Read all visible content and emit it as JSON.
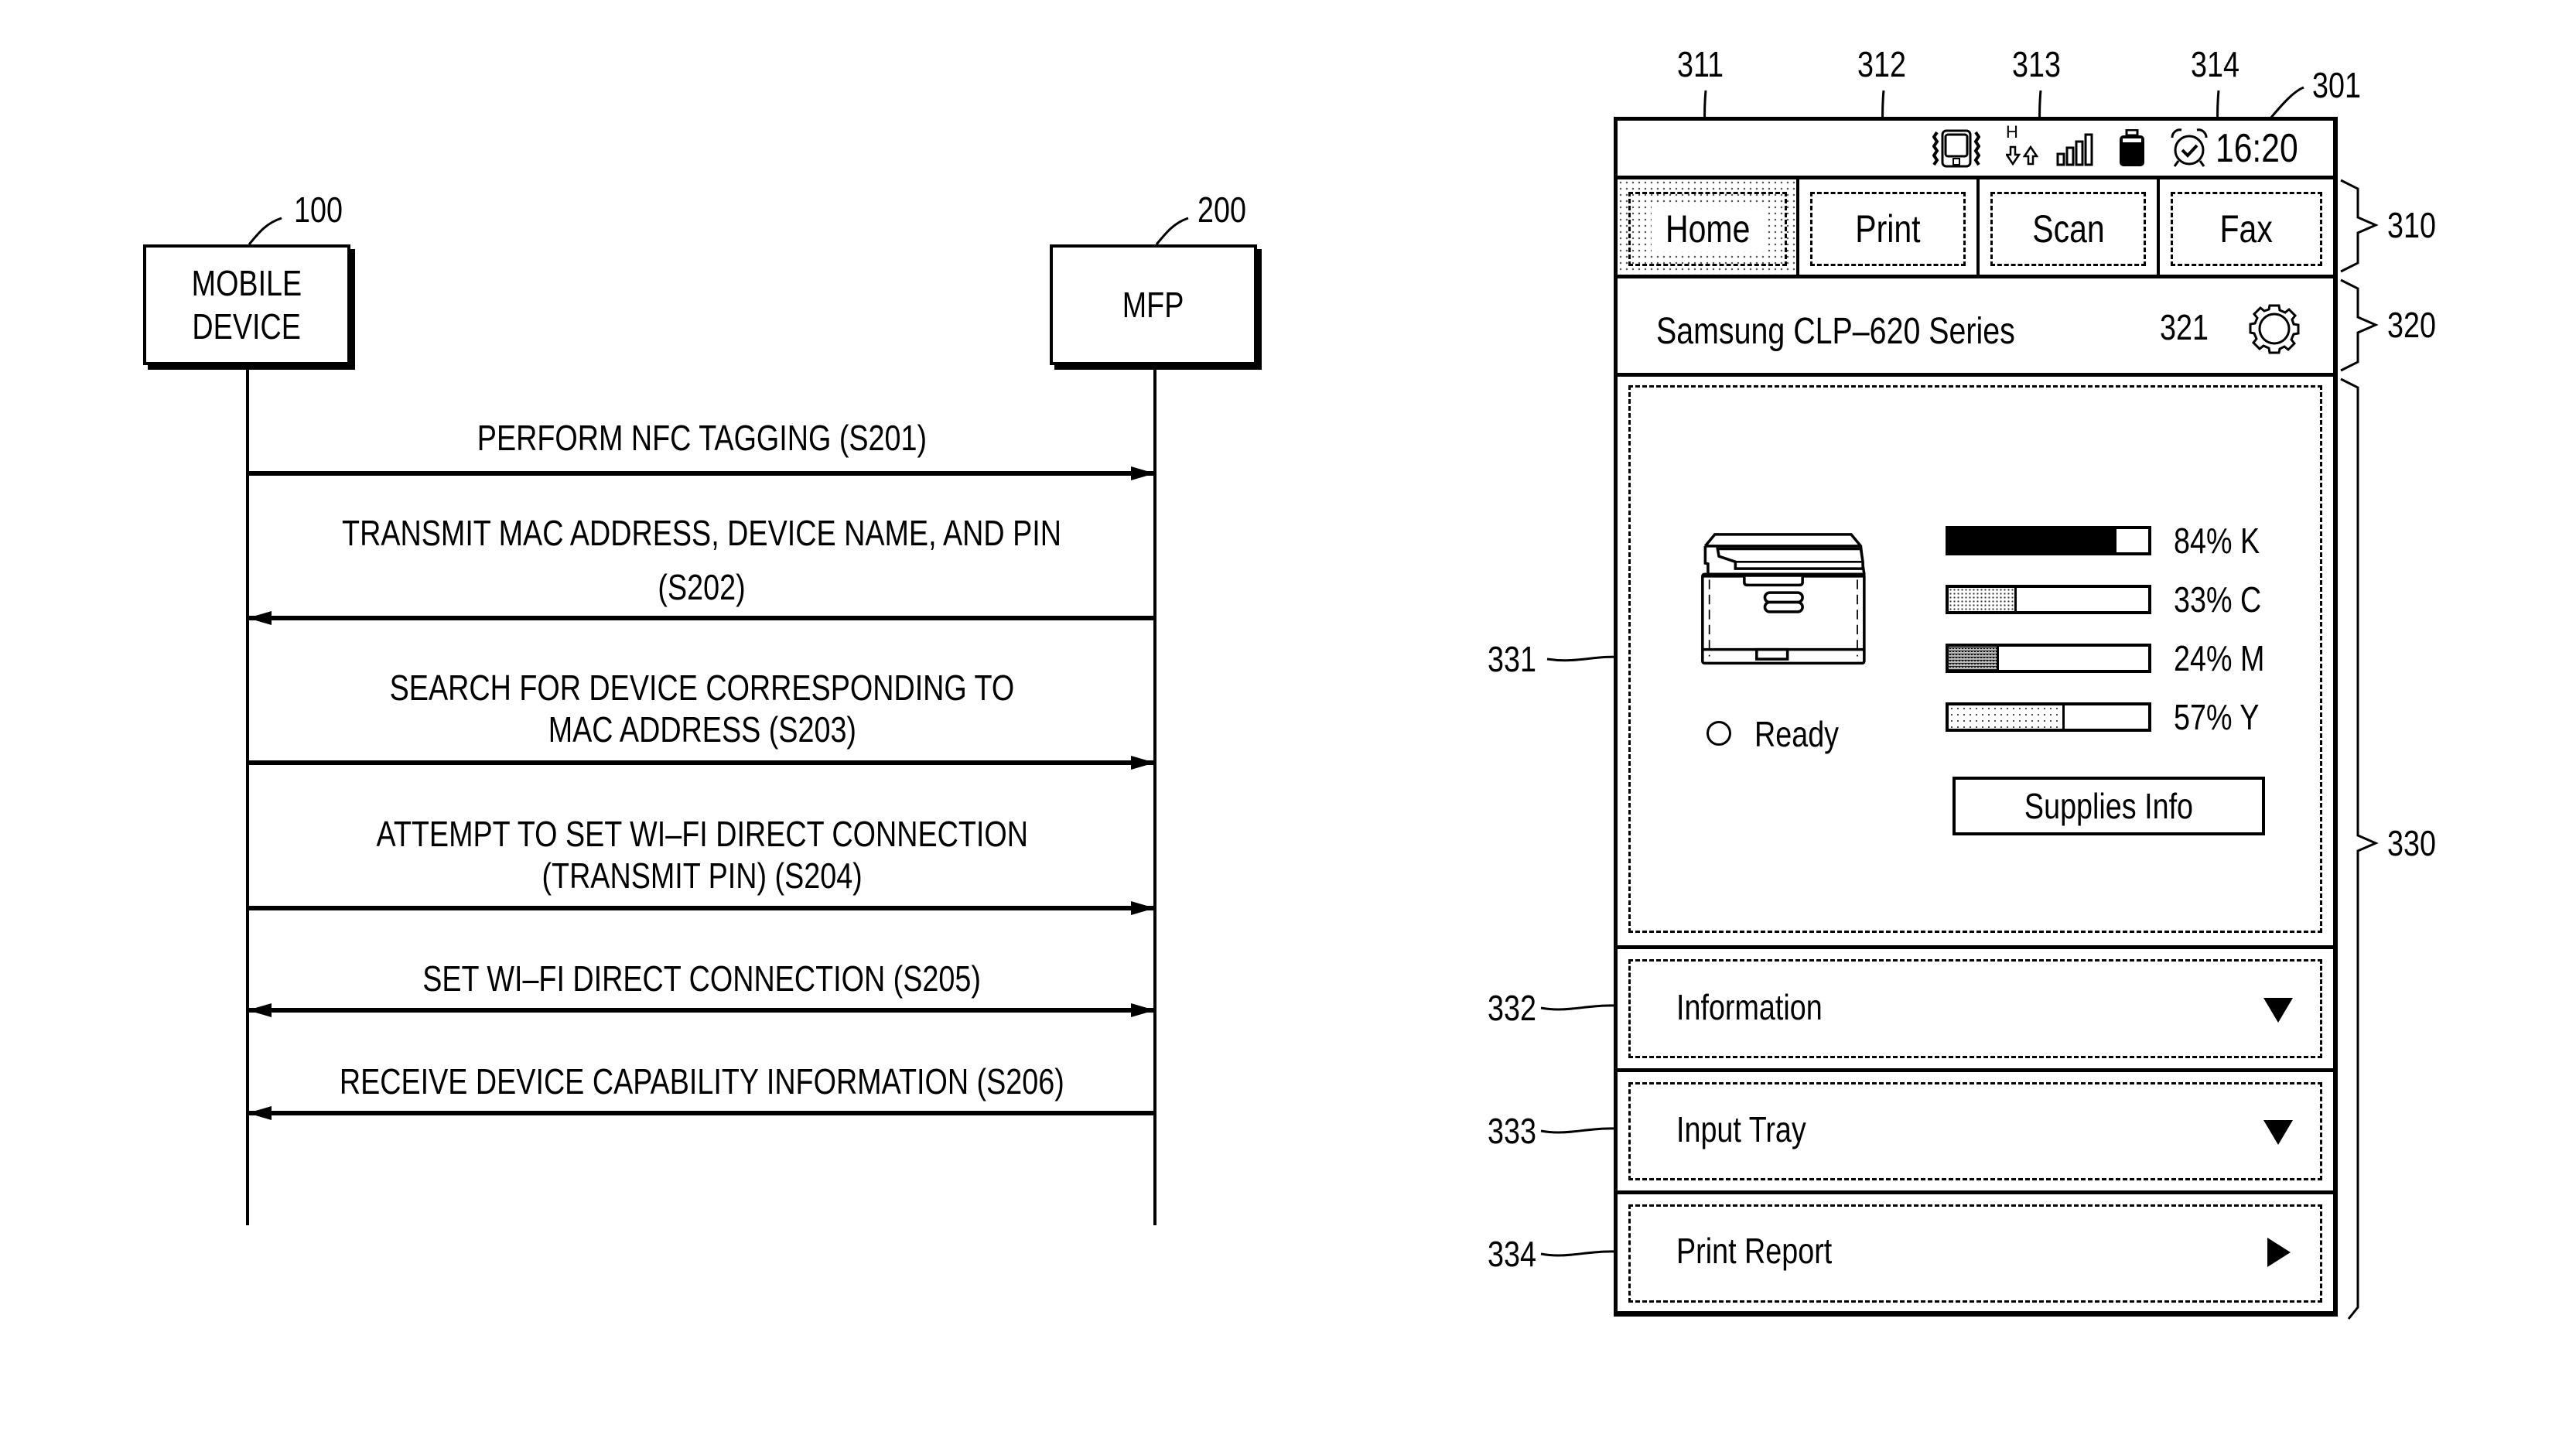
{
  "sequence_diagram": {
    "entities": [
      {
        "ref": "100",
        "label_lines": [
          "MOBILE",
          "DEVICE"
        ]
      },
      {
        "ref": "200",
        "label_lines": [
          "MFP"
        ]
      }
    ],
    "messages": [
      {
        "step": "S201",
        "direction": "mobile-to-mfp",
        "lines": [
          "PERFORM NFC TAGGING (S201)"
        ]
      },
      {
        "step": "S202",
        "direction": "mfp-to-mobile",
        "lines": [
          "TRANSMIT MAC ADDRESS, DEVICE NAME, AND PIN",
          "(S202)"
        ]
      },
      {
        "step": "S203",
        "direction": "mobile-to-mfp",
        "lines": [
          "SEARCH FOR DEVICE CORRESPONDING TO",
          "MAC ADDRESS (S203)"
        ]
      },
      {
        "step": "S204",
        "direction": "mobile-to-mfp",
        "lines": [
          "ATTEMPT TO SET WI–FI DIRECT CONNECTION",
          "(TRANSMIT PIN) (S204)"
        ]
      },
      {
        "step": "S205",
        "direction": "bidirectional",
        "lines": [
          "SET WI–FI DIRECT CONNECTION (S205)"
        ]
      },
      {
        "step": "S206",
        "direction": "mfp-to-mobile",
        "lines": [
          "RECEIVE DEVICE CAPABILITY INFORMATION (S206)"
        ]
      }
    ]
  },
  "phone_ui": {
    "ref": "301",
    "status_bar": {
      "icons": [
        "vibrate-icon",
        "hsdpa-data-icon",
        "signal-strength-icon",
        "battery-icon",
        "alarm-icon"
      ],
      "data_indicator": "H",
      "time": "16:20"
    },
    "tab_bar": {
      "ref": "310",
      "tabs": [
        {
          "ref": "311",
          "label": "Home",
          "active": true
        },
        {
          "ref": "312",
          "label": "Print",
          "active": false
        },
        {
          "ref": "313",
          "label": "Scan",
          "active": false
        },
        {
          "ref": "314",
          "label": "Fax",
          "active": false
        }
      ]
    },
    "header": {
      "ref": "320",
      "title": "Samsung CLP–620 Series",
      "settings_ref": "321",
      "settings_icon": "gear-icon"
    },
    "content": {
      "ref": "330",
      "status_panel": {
        "ref": "331",
        "printer_icon": "printer-icon",
        "status": "Ready",
        "toners": [
          {
            "color": "K",
            "percent": 84,
            "label": "84% K"
          },
          {
            "color": "C",
            "percent": 33,
            "label": "33% C"
          },
          {
            "color": "M",
            "percent": 24,
            "label": "24% M"
          },
          {
            "color": "Y",
            "percent": 57,
            "label": "57% Y"
          }
        ],
        "supplies_button": "Supplies Info"
      },
      "menu_items": [
        {
          "ref": "332",
          "label": "Information",
          "indicator": "expand-down"
        },
        {
          "ref": "333",
          "label": "Input Tray",
          "indicator": "expand-down"
        },
        {
          "ref": "334",
          "label": "Print Report",
          "indicator": "navigate-right"
        }
      ]
    }
  }
}
